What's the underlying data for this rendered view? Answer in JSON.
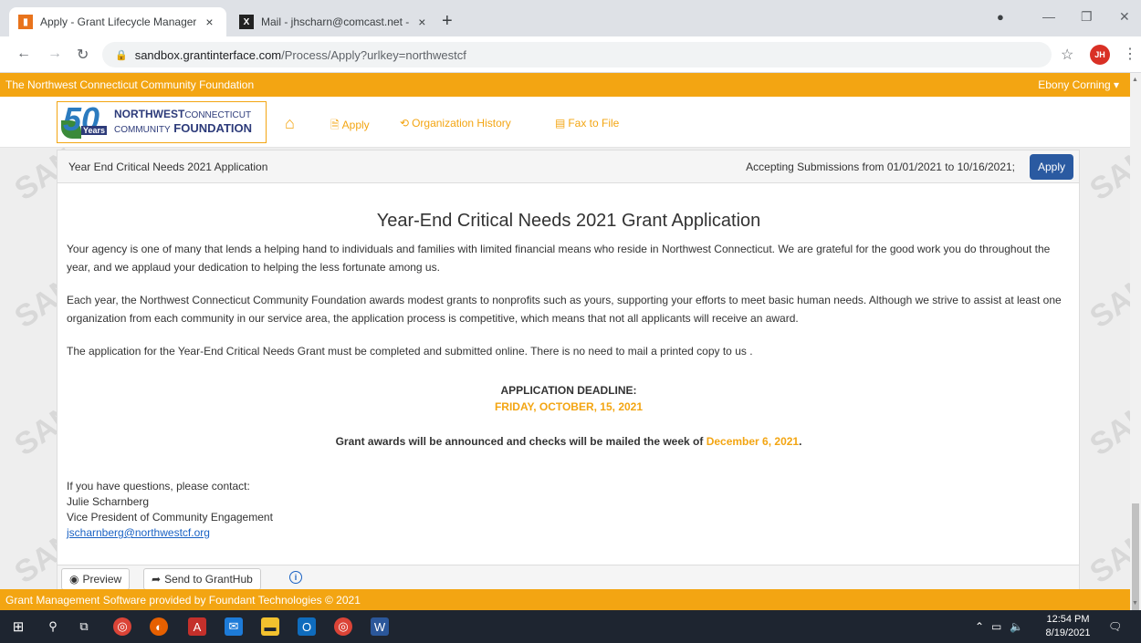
{
  "browser": {
    "tabs": [
      {
        "title": "Apply - Grant Lifecycle Manager",
        "close": "×"
      },
      {
        "title": "Mail - jhscharn@comcast.net - ",
        "close": "×"
      }
    ],
    "new_tab": "+",
    "url_host": "sandbox.grantinterface.com",
    "url_path": "/Process/Apply?urlkey=northwestcf",
    "profile_initials": "JH"
  },
  "top_band": {
    "org_name": "The Northwest Connecticut Community Foundation",
    "user": "Ebony Corning ▾"
  },
  "logo": {
    "number": "50",
    "years": "Years",
    "line1_bold": "NORTHWEST",
    "line1_rest": "CONNECTICUT",
    "line2_rest": "COMMUNITY",
    "line2_bold": "FOUNDATION"
  },
  "nav": {
    "apply": "Apply",
    "org_history": "Organization History",
    "fax": "Fax to File"
  },
  "watermark": "SAN",
  "panel": {
    "title": "Year End Critical Needs 2021 Application",
    "accepting": "Accepting Submissions from 01/01/2021 to 10/16/2021;",
    "apply_button": "Apply",
    "heading": "Year-End Critical Needs 2021 Grant Application",
    "para1": "Your agency is one of many that lends a helping hand to individuals and families with limited financial means who reside in Northwest Connecticut. We are grateful for the good work you do throughout the year, and we applaud your dedication to helping the less fortunate among us.",
    "para2": "Each year, the Northwest Connecticut Community Foundation awards modest grants to nonprofits such as yours, supporting your efforts to meet basic human needs. Although we strive to assist at least one organization from each community in our service area, the application process is competitive, which means that not all applicants will receive an award.",
    "para3": "The application for the Year-End Critical Needs Grant must be completed and submitted online. There is no need to mail a printed copy to us .",
    "deadline_label": "APPLICATION DEADLINE:",
    "deadline_date": "FRIDAY, OCTOBER, 15, 2021",
    "awards_text": "Grant awards will be announced and checks will be mailed the week of",
    "awards_date": "December 6, 2021",
    "awards_end": ".",
    "contact_intro": "If you have questions, please contact:",
    "contact_name": "Julie Scharnberg",
    "contact_title": "Vice President of Community Engagement",
    "contact_email": "jscharnberg@northwestcf.org",
    "preview_button": "Preview",
    "send_button": "Send to GrantHub"
  },
  "footer": {
    "text": "Grant Management Software provided by Foundant Technologies © 2021"
  },
  "taskbar": {
    "time": "12:54 PM",
    "date": "8/19/2021"
  }
}
